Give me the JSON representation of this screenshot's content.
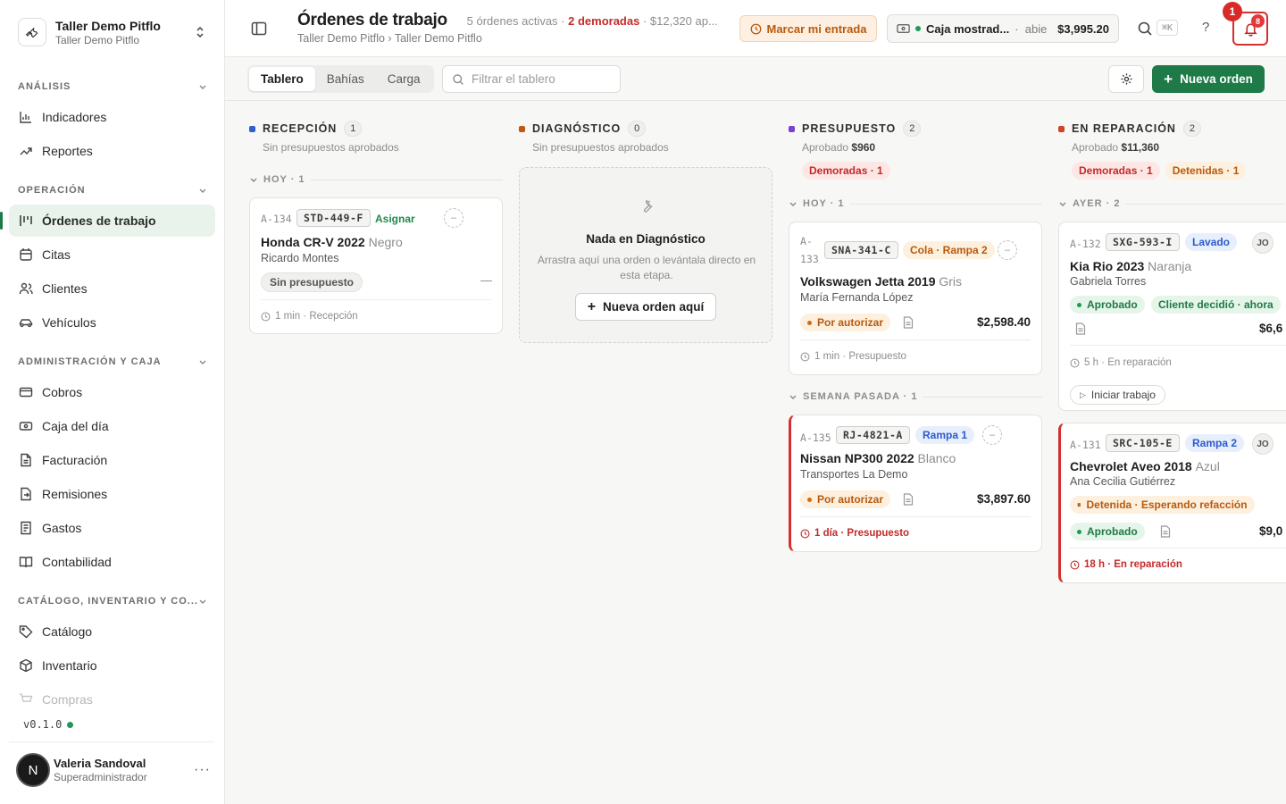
{
  "org": {
    "name": "Taller Demo Pitflo",
    "subtitle": "Taller Demo Pitflo"
  },
  "sidebar": {
    "sections": [
      {
        "label": "ANÁLISIS"
      },
      {
        "label": "OPERACIÓN"
      },
      {
        "label": "ADMINISTRACIÓN Y CAJA"
      },
      {
        "label": "CATÁLOGO, INVENTARIO Y CO..."
      }
    ],
    "items": [
      {
        "label": "Indicadores",
        "icon": "bar-chart-icon"
      },
      {
        "label": "Reportes",
        "icon": "trend-icon"
      },
      {
        "label": "Órdenes de trabajo",
        "icon": "kanban-icon"
      },
      {
        "label": "Citas",
        "icon": "calendar-icon"
      },
      {
        "label": "Clientes",
        "icon": "users-icon"
      },
      {
        "label": "Vehículos",
        "icon": "car-icon"
      },
      {
        "label": "Cobros",
        "icon": "wallet-icon"
      },
      {
        "label": "Caja del día",
        "icon": "cash-icon"
      },
      {
        "label": "Facturación",
        "icon": "file-icon"
      },
      {
        "label": "Remisiones",
        "icon": "file-arrow-icon"
      },
      {
        "label": "Gastos",
        "icon": "receipt-icon"
      },
      {
        "label": "Contabilidad",
        "icon": "book-icon"
      },
      {
        "label": "Catálogo",
        "icon": "tag-icon"
      },
      {
        "label": "Inventario",
        "icon": "box-icon"
      },
      {
        "label": "Compras",
        "icon": "cart-icon"
      }
    ],
    "version": "v0.1.0",
    "user": {
      "initial": "N",
      "name": "Valeria Sandoval",
      "role": "Superadministrador"
    }
  },
  "header": {
    "title": "Órdenes de trabajo",
    "meta_active": "5 órdenes activas",
    "meta_late": "2 demoradas",
    "meta_amount": "$12,320 ap...",
    "breadcrumb": "Taller Demo Pitflo › Taller Demo Pitflo",
    "entrada_label": "Marcar mi entrada",
    "caja_name": "Caja mostrad...",
    "caja_state": "abie",
    "caja_amount": "$3,995.20",
    "kbd": "⌘K",
    "help": "?",
    "notif_count": "8",
    "bubble": "1"
  },
  "toolbar": {
    "tabs": [
      "Tablero",
      "Bahías",
      "Carga"
    ],
    "filter_placeholder": "Filtrar el tablero",
    "new_order": "Nueva orden"
  },
  "columns": {
    "recepcion": {
      "title": "RECEPCIÓN",
      "count": "1",
      "sub": "Sin presupuestos aprobados",
      "color": "#2f5fd0",
      "group": "HOY · 1",
      "card": {
        "id": "A-134",
        "plate": "STD-449-F",
        "assign": "Asignar",
        "vehicle": "Honda CR-V 2022",
        "color": "Negro",
        "owner": "Ricardo Montes",
        "status": "Sin presupuesto",
        "dash": "—",
        "foot": "1 min · Recepción"
      }
    },
    "diagnostico": {
      "title": "DIAGNÓSTICO",
      "count": "0",
      "sub": "Sin presupuestos aprobados",
      "color": "#c2570f",
      "empty_title": "Nada en Diagnóstico",
      "empty_desc": "Arrastra aquí una orden o levántala directo en esta etapa.",
      "empty_btn": "Nueva orden aquí"
    },
    "presupuesto": {
      "title": "PRESUPUESTO",
      "count": "2",
      "sub_prefix": "Aprobado",
      "sub_amount": "$960",
      "color": "#7b3fd6",
      "pill_late": "Demoradas · 1",
      "group1": "HOY · 1",
      "group2": "SEMANA PASADA · 1",
      "card1": {
        "id_a": "A-",
        "id_b": "133",
        "plate": "SNA-341-C",
        "tag": "Cola · Rampa 2",
        "vehicle": "Volkswagen Jetta 2019",
        "color": "Gris",
        "owner": "María Fernanda López",
        "status": "Por autorizar",
        "amount": "$2,598.40",
        "foot": "1 min · Presupuesto"
      },
      "card2": {
        "id": "A-135",
        "plate": "RJ-4821-A",
        "tag": "Rampa 1",
        "vehicle": "Nissan NP300 2022",
        "color": "Blanco",
        "owner": "Transportes La Demo",
        "status": "Por autorizar",
        "amount": "$3,897.60",
        "foot": "1 día · Presupuesto"
      }
    },
    "reparacion": {
      "title": "EN REPARACIÓN",
      "count": "2",
      "sub_prefix": "Aprobado",
      "sub_amount": "$11,360",
      "color": "#d0451f",
      "pill_late": "Demoradas · 1",
      "pill_stopped": "Detenidas · 1",
      "group": "AYER · 2",
      "card1": {
        "id": "A-132",
        "plate": "SXG-593-I",
        "tag": "Lavado",
        "initials": "JO",
        "vehicle": "Kia Rio 2023",
        "color": "Naranja",
        "owner": "Gabriela Torres",
        "status": "Aprobado",
        "decision": "Cliente decidió · ahora",
        "amount": "$6,6",
        "foot": "5 h · En reparación",
        "start": "Iniciar trabajo"
      },
      "card2": {
        "id": "A-131",
        "plate": "SRC-105-E",
        "tag": "Rampa 2",
        "initials": "JO",
        "vehicle": "Chevrolet Aveo 2018",
        "color": "Azul",
        "owner": "Ana Cecilia Gutiérrez",
        "stopped": "Detenida · Esperando refacción",
        "status": "Aprobado",
        "amount": "$9,0",
        "foot": "18 h · En reparación"
      }
    }
  }
}
